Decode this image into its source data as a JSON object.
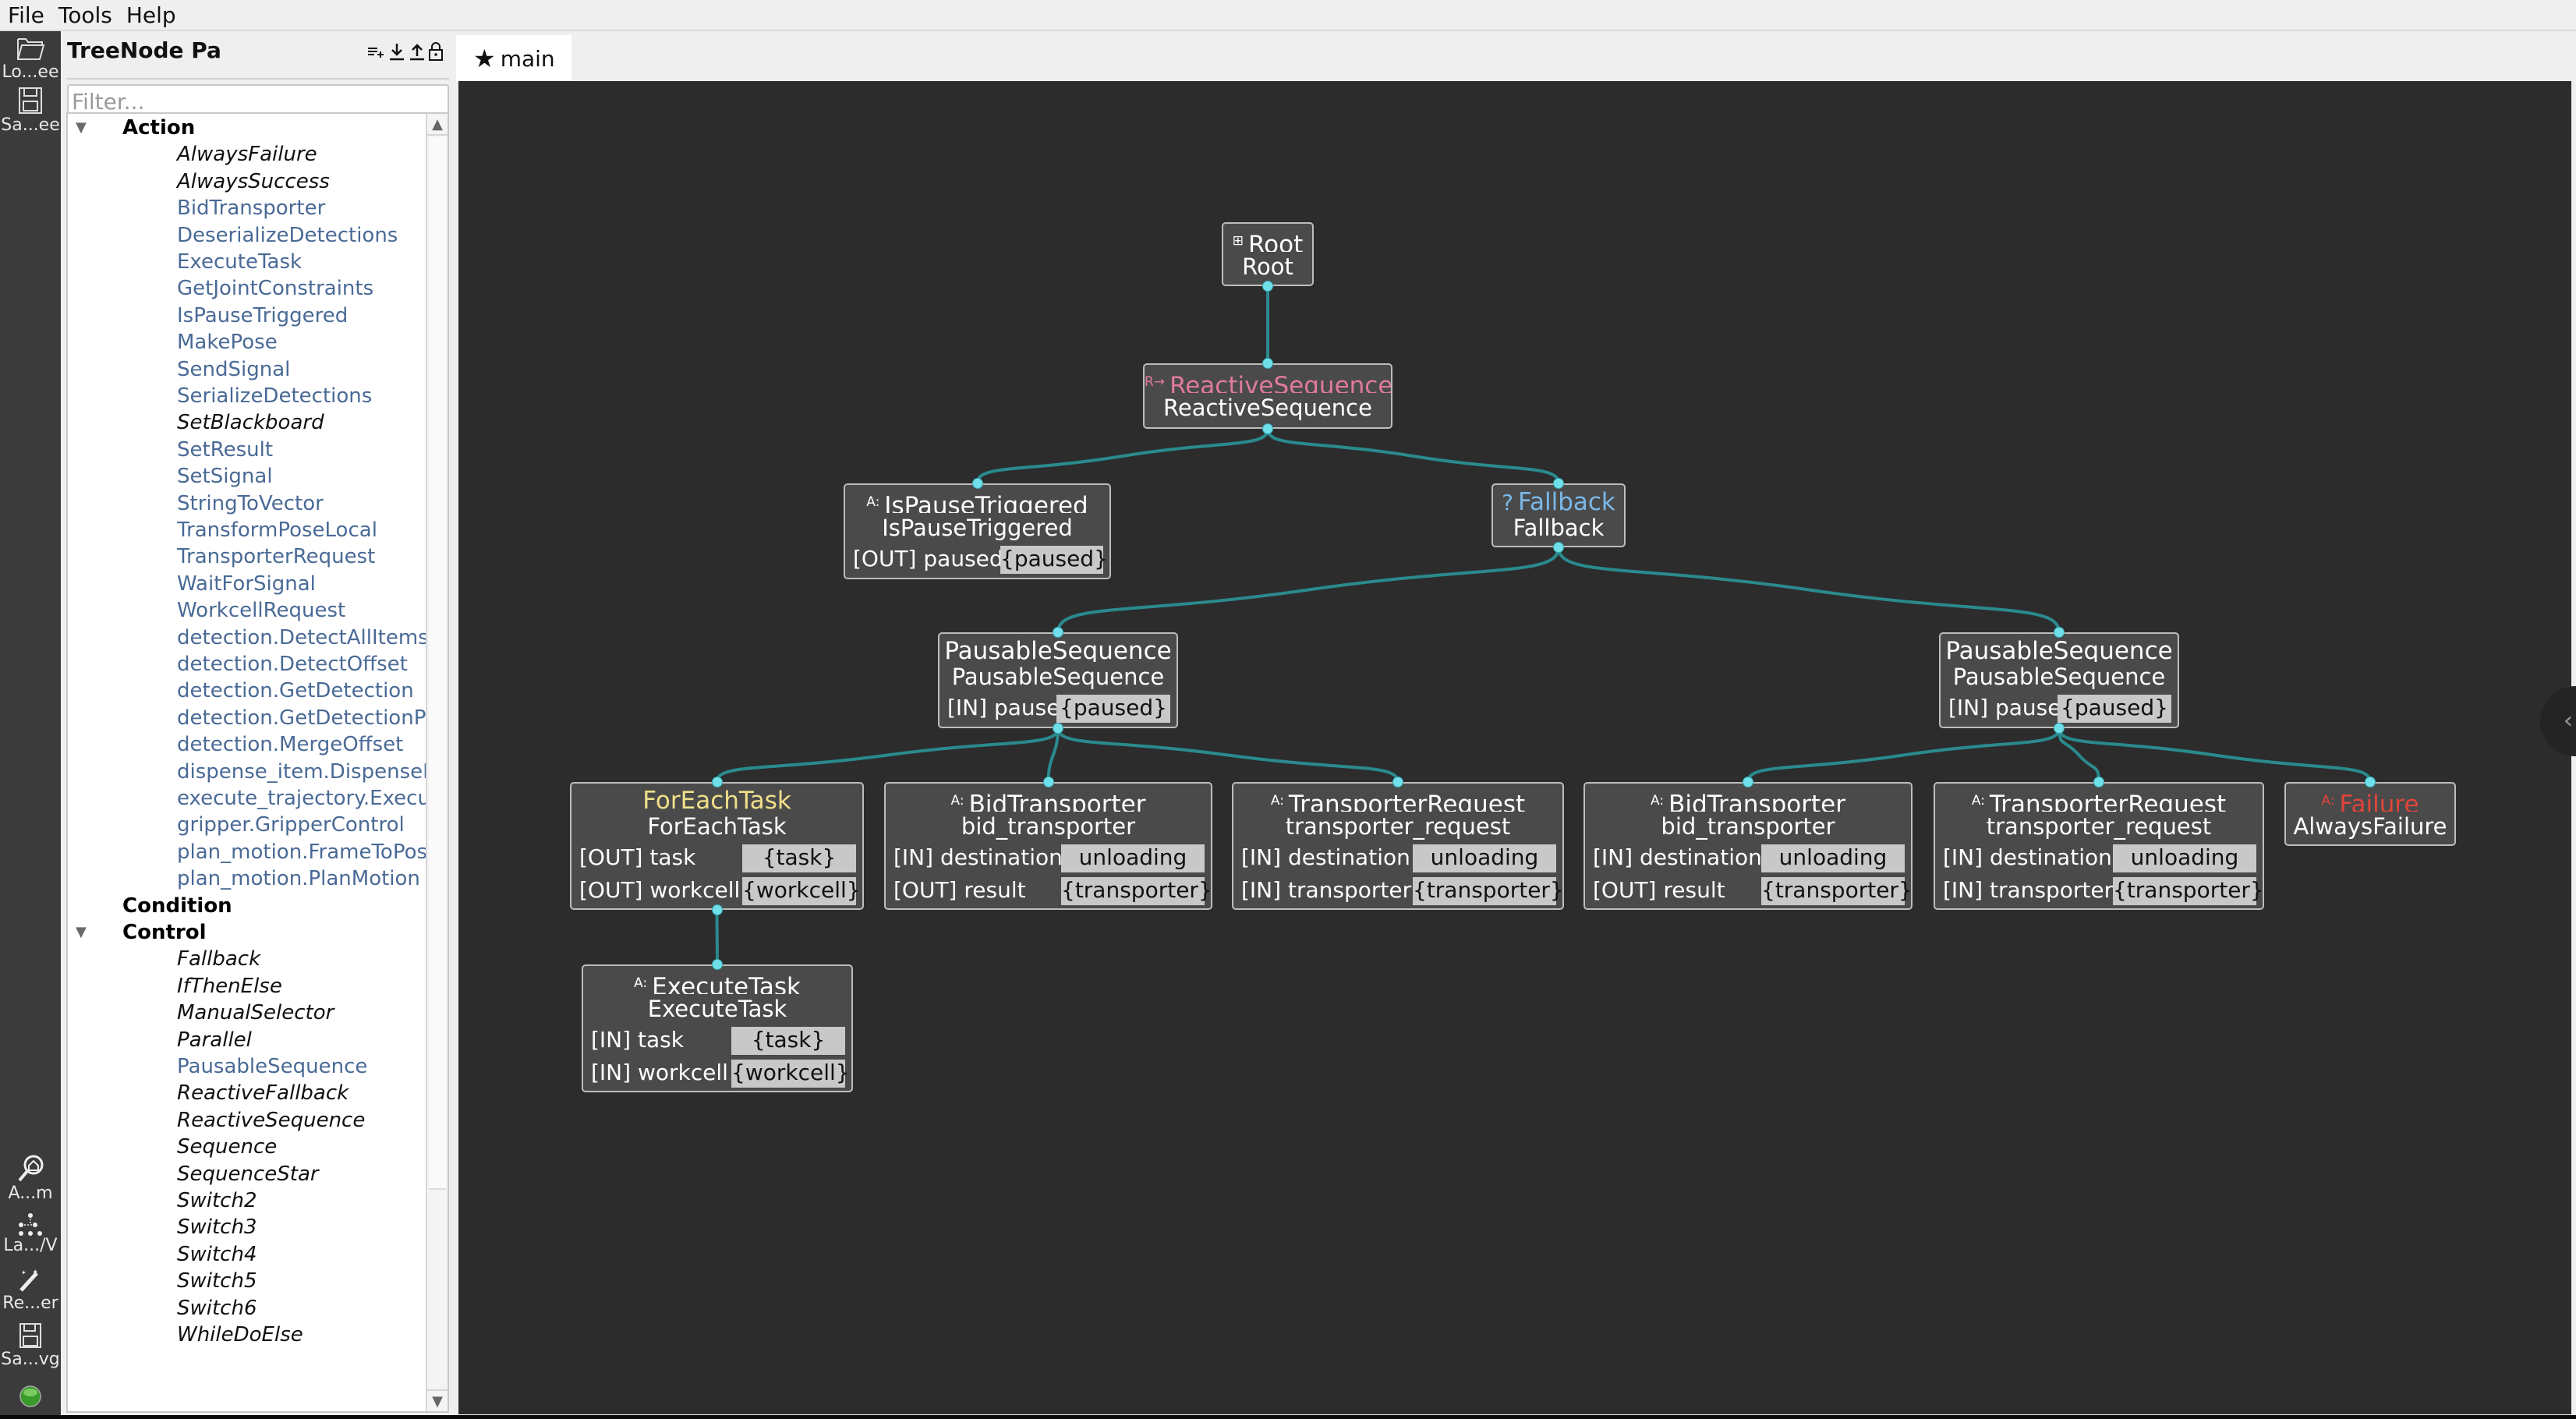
{
  "menubar": [
    "File",
    "Tools",
    "Help"
  ],
  "leftbar": [
    {
      "icon": "folder-open-icon",
      "label": "Lo...ee"
    },
    {
      "icon": "save-icon",
      "label": "Sa...ee"
    },
    {
      "icon": "zoom-home-icon",
      "label": "A...m"
    },
    {
      "icon": "tree-layout-icon",
      "label": "La.../V"
    },
    {
      "icon": "magic-wand-icon",
      "label": "Re...er"
    },
    {
      "icon": "save-svg-icon",
      "label": "Sa...vg"
    },
    {
      "icon": "status-led-icon",
      "label": ""
    }
  ],
  "palette": {
    "title": "TreeNode Palette",
    "tools": [
      "add-list-icon",
      "download-icon",
      "upload-icon",
      "lock-icon"
    ],
    "filter_placeholder": "Filter...",
    "filter_value": "",
    "categories": [
      {
        "name": "Action",
        "expanded": true,
        "items": [
          {
            "label": "AlwaysFailure",
            "builtin": true
          },
          {
            "label": "AlwaysSuccess",
            "builtin": true
          },
          {
            "label": "BidTransporter",
            "builtin": false
          },
          {
            "label": "DeserializeDetections",
            "builtin": false
          },
          {
            "label": "ExecuteTask",
            "builtin": false
          },
          {
            "label": "GetJointConstraints",
            "builtin": false
          },
          {
            "label": "IsPauseTriggered",
            "builtin": false
          },
          {
            "label": "MakePose",
            "builtin": false
          },
          {
            "label": "SendSignal",
            "builtin": false
          },
          {
            "label": "SerializeDetections",
            "builtin": false
          },
          {
            "label": "SetBlackboard",
            "builtin": true
          },
          {
            "label": "SetResult",
            "builtin": false
          },
          {
            "label": "SetSignal",
            "builtin": false
          },
          {
            "label": "StringToVector",
            "builtin": false
          },
          {
            "label": "TransformPoseLocal",
            "builtin": false
          },
          {
            "label": "TransporterRequest",
            "builtin": false
          },
          {
            "label": "WaitForSignal",
            "builtin": false
          },
          {
            "label": "WorkcellRequest",
            "builtin": false
          },
          {
            "label": "detection.DetectAllItems",
            "builtin": false
          },
          {
            "label": "detection.DetectOffset",
            "builtin": false
          },
          {
            "label": "detection.GetDetection",
            "builtin": false
          },
          {
            "label": "detection.GetDetectionPose",
            "builtin": false
          },
          {
            "label": "detection.MergeOffset",
            "builtin": false
          },
          {
            "label": "dispense_item.DispenseItem",
            "builtin": false
          },
          {
            "label": "execute_trajectory.Execute...",
            "builtin": false
          },
          {
            "label": "gripper.GripperControl",
            "builtin": false
          },
          {
            "label": "plan_motion.FrameToPose",
            "builtin": false
          },
          {
            "label": "plan_motion.PlanMotion",
            "builtin": false
          }
        ]
      },
      {
        "name": "Condition",
        "expanded": false,
        "items": []
      },
      {
        "name": "Control",
        "expanded": true,
        "items": [
          {
            "label": "Fallback",
            "builtin": true
          },
          {
            "label": "IfThenElse",
            "builtin": true
          },
          {
            "label": "ManualSelector",
            "builtin": true
          },
          {
            "label": "Parallel",
            "builtin": true
          },
          {
            "label": "PausableSequence",
            "builtin": false
          },
          {
            "label": "ReactiveFallback",
            "builtin": true
          },
          {
            "label": "ReactiveSequence",
            "builtin": true
          },
          {
            "label": "Sequence",
            "builtin": true
          },
          {
            "label": "SequenceStar",
            "builtin": true
          },
          {
            "label": "Switch2",
            "builtin": true
          },
          {
            "label": "Switch3",
            "builtin": true
          },
          {
            "label": "Switch4",
            "builtin": true
          },
          {
            "label": "Switch5",
            "builtin": true
          },
          {
            "label": "Switch6",
            "builtin": true
          },
          {
            "label": "WhileDoElse",
            "builtin": true
          }
        ]
      }
    ]
  },
  "tabs": [
    {
      "label": "main",
      "icon": "star-icon",
      "active": true
    }
  ],
  "colors": {
    "edge": "#2a8a8e",
    "port_dot": "#6fe0ea",
    "reactive": "#e07a9e",
    "fallback": "#7ab8e8",
    "decorator": "#f0e08a",
    "failure": "#e0453a",
    "plain": "#ffffff"
  },
  "tree": {
    "nodes": [
      {
        "id": "root",
        "type": "Root",
        "name": "Root",
        "badge": "root-icon",
        "badge_text": "",
        "color": "plain",
        "ports": []
      },
      {
        "id": "rseq",
        "type": "ReactiveSequence",
        "name": "ReactiveSequence",
        "badge": "reactive-icon",
        "badge_text": "R→",
        "color": "reactive",
        "ports": []
      },
      {
        "id": "ispause",
        "type": "IsPauseTriggered",
        "name": "IsPauseTriggered",
        "badge": "action-icon",
        "badge_text": "A:",
        "color": "plain",
        "ports": [
          {
            "dir": "[OUT]",
            "name": "paused",
            "value": "{paused}"
          }
        ]
      },
      {
        "id": "fallback",
        "type": "Fallback",
        "name": "Fallback",
        "badge": "fallback-icon",
        "badge_text": "?",
        "color": "fallback",
        "ports": []
      },
      {
        "id": "ps1",
        "type": "PausableSequence",
        "name": "PausableSequence",
        "badge": "",
        "badge_text": "",
        "color": "plain",
        "ports": [
          {
            "dir": "[IN]",
            "name": "pause",
            "value": "{paused}"
          }
        ]
      },
      {
        "id": "ps2",
        "type": "PausableSequence",
        "name": "PausableSequence",
        "badge": "",
        "badge_text": "",
        "color": "plain",
        "ports": [
          {
            "dir": "[IN]",
            "name": "pause",
            "value": "{paused}"
          }
        ]
      },
      {
        "id": "foreach",
        "type": "ForEachTask",
        "name": "ForEachTask",
        "badge": "",
        "badge_text": "",
        "color": "decorator",
        "ports": [
          {
            "dir": "[OUT]",
            "name": "task",
            "value": "{task}"
          },
          {
            "dir": "[OUT]",
            "name": "workcell",
            "value": "{workcell}"
          }
        ]
      },
      {
        "id": "bt1",
        "type": "BidTransporter",
        "name": "bid_transporter",
        "badge": "action-icon",
        "badge_text": "A:",
        "color": "plain",
        "ports": [
          {
            "dir": "[IN]",
            "name": "destination",
            "value": "unloading"
          },
          {
            "dir": "[OUT]",
            "name": "result",
            "value": "{transporter}"
          }
        ]
      },
      {
        "id": "tr1",
        "type": "TransporterRequest",
        "name": "transporter_request",
        "badge": "action-icon",
        "badge_text": "A:",
        "color": "plain",
        "ports": [
          {
            "dir": "[IN]",
            "name": "destination",
            "value": "unloading"
          },
          {
            "dir": "[IN]",
            "name": "transporter",
            "value": "{transporter}"
          }
        ]
      },
      {
        "id": "bt2",
        "type": "BidTransporter",
        "name": "bid_transporter",
        "badge": "action-icon",
        "badge_text": "A:",
        "color": "plain",
        "ports": [
          {
            "dir": "[IN]",
            "name": "destination",
            "value": "unloading"
          },
          {
            "dir": "[OUT]",
            "name": "result",
            "value": "{transporter}"
          }
        ]
      },
      {
        "id": "tr2",
        "type": "TransporterRequest",
        "name": "transporter_request",
        "badge": "action-icon",
        "badge_text": "A:",
        "color": "plain",
        "ports": [
          {
            "dir": "[IN]",
            "name": "destination",
            "value": "unloading"
          },
          {
            "dir": "[IN]",
            "name": "transporter",
            "value": "{transporter}"
          }
        ]
      },
      {
        "id": "fail",
        "type": "Failure",
        "name": "AlwaysFailure",
        "badge": "action-icon",
        "badge_text": "A:",
        "color": "failure",
        "ports": []
      },
      {
        "id": "exec",
        "type": "ExecuteTask",
        "name": "ExecuteTask",
        "badge": "action-icon",
        "badge_text": "A:",
        "color": "plain",
        "ports": [
          {
            "dir": "[IN]",
            "name": "task",
            "value": "{task}"
          },
          {
            "dir": "[IN]",
            "name": "workcell",
            "value": "{workcell}"
          }
        ]
      }
    ],
    "edges": [
      [
        "root",
        "rseq"
      ],
      [
        "rseq",
        "ispause"
      ],
      [
        "rseq",
        "fallback"
      ],
      [
        "fallback",
        "ps1"
      ],
      [
        "fallback",
        "ps2"
      ],
      [
        "ps1",
        "foreach"
      ],
      [
        "ps1",
        "bt1"
      ],
      [
        "ps1",
        "tr1"
      ],
      [
        "ps2",
        "bt2"
      ],
      [
        "ps2",
        "tr2"
      ],
      [
        "ps2",
        "fail"
      ],
      [
        "foreach",
        "exec"
      ]
    ]
  }
}
